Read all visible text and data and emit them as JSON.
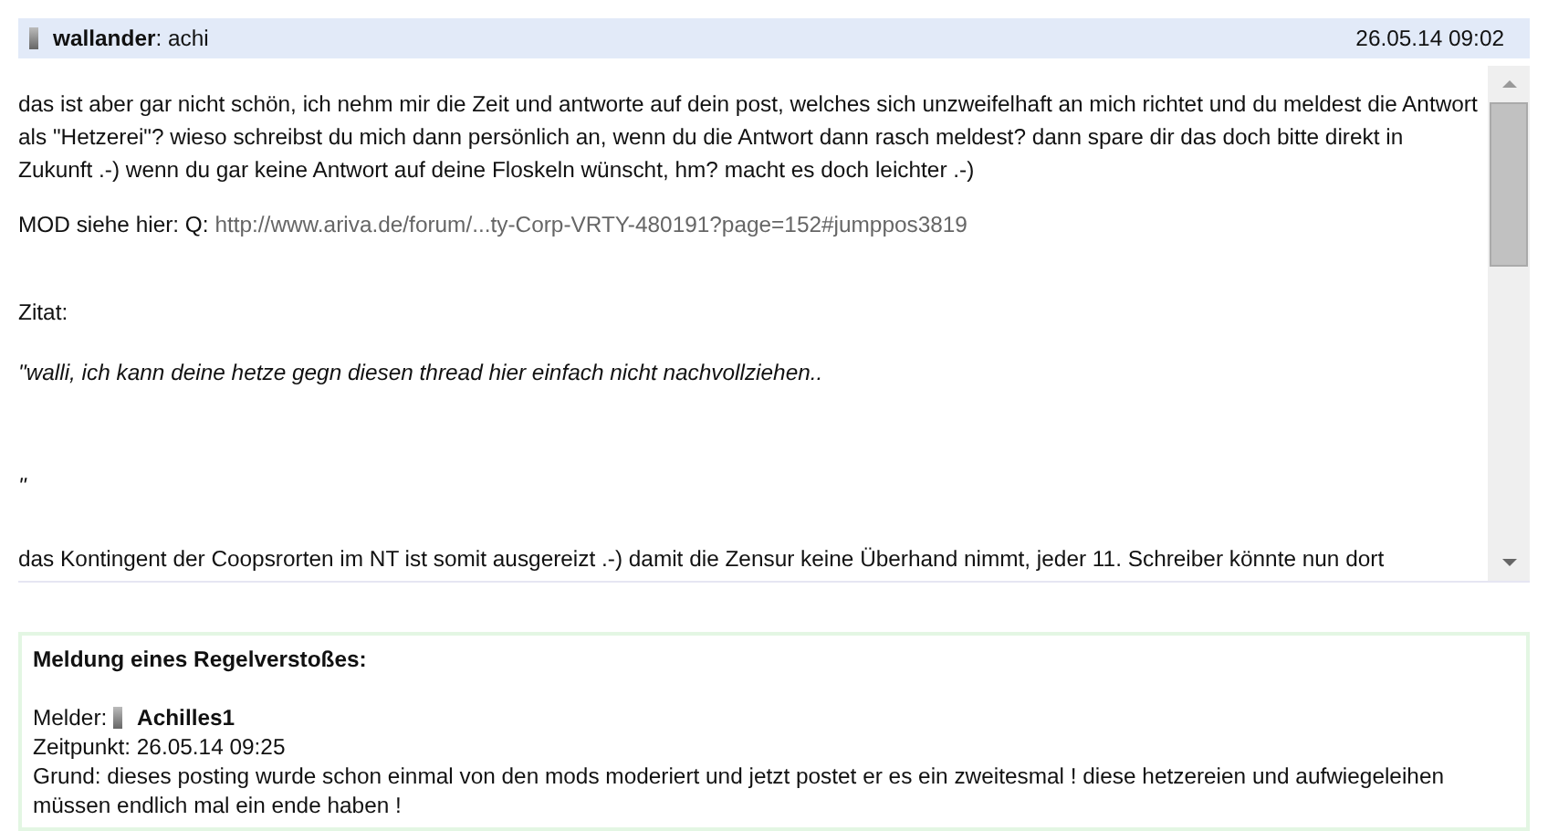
{
  "post": {
    "author": "wallander",
    "separator": ":",
    "recipient": "achi",
    "timestamp": "26.05.14 09:02",
    "body": "das ist aber gar nicht schön, ich nehm mir die Zeit und antworte auf dein post, welches sich unzweifelhaft an mich richtet und du meldest die Antwort als \"Hetzerei\"? wieso schreibst du mich dann persönlich an, wenn du die Antwort dann rasch meldest? dann spare dir das doch bitte direkt in Zukunft .-) wenn du gar keine Antwort auf deine Floskeln wünscht, hm? macht es doch leichter .-)",
    "mod_label": "MOD siehe hier: Q:",
    "mod_link": "http://www.ariva.de/forum/...ty-Corp-VRTY-480191?page=152#jumppos3819",
    "quote_label": "Zitat:",
    "quote_text": "\"walli, ich kann deine hetze gegn diesen thread hier einfach nicht nachvollziehen..",
    "quote_end": "\"",
    "cut_line": "das Kontingent der Coopsrorten im NT ist somit ausgereizt .-) damit die Zensur keine Überhand nimmt, jeder 11. Schreiber könnte nun dort"
  },
  "report": {
    "title": "Meldung eines Regelverstoßes:",
    "reporter_label": "Melder:",
    "reporter": "Achilles1",
    "time": "Zeitpunkt: 26.05.14 09:25",
    "reason": "Grund: dieses posting wurde schon einmal von den mods moderiert und jetzt postet er es ein zweitesmal ! diese hetzereien und aufwiegeleihen müssen endlich mal ein ende haben !"
  }
}
